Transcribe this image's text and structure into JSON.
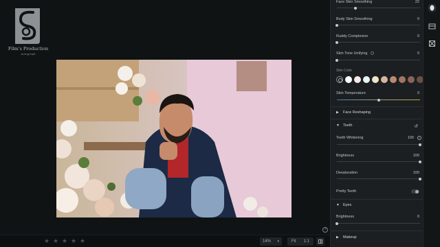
{
  "logo": {
    "title": "Film's Production",
    "subtitle": "Autograph"
  },
  "panel": {
    "rows_top": [
      {
        "label": "Face Skin Smoothing",
        "value": "22",
        "level": 0.22
      },
      {
        "label": "Body Skin Smoothing",
        "value": "0",
        "level": 0
      },
      {
        "label": "Ruddy Complexion",
        "value": "0",
        "level": 0
      },
      {
        "label": "Skin Tone Unifying",
        "value": "0",
        "level": 0
      }
    ],
    "skin_color_label": "Skin Color",
    "skin_colors": [
      "#ffffff",
      "#f6ebe6",
      "#e8f4f8",
      "#f2e4cc",
      "#d9b59e",
      "#b78b72",
      "#9f7564",
      "#8a6557",
      "#6d4e42"
    ],
    "skin_temperature": {
      "label": "Skin Temperature",
      "value": "0",
      "level": 0.5
    },
    "sections": {
      "face_reshaping": "Face Reshaping",
      "teeth": "Teeth",
      "eyes": "Eyes",
      "makeup": "Makeup"
    },
    "teeth_rows": [
      {
        "label": "Teeth Whitening",
        "value": "100",
        "level": 1
      },
      {
        "label": "Brightness",
        "value": "100",
        "level": 1
      },
      {
        "label": "Desaturation",
        "value": "100",
        "level": 1
      }
    ],
    "pretty_teeth": {
      "label": "Pretty Teeth",
      "on": false
    },
    "eyes_rows": [
      {
        "label": "Brightness",
        "value": "0",
        "level": 0
      }
    ]
  },
  "bottom": {
    "stars": [
      "★",
      "★",
      "★",
      "★",
      "★"
    ],
    "zoom": "14%",
    "fit_label": "Fit",
    "one_to_one": "1:1"
  },
  "rail": {
    "icons": [
      "face-icon",
      "panel-icon",
      "crop-icon"
    ]
  },
  "colors": {
    "background": "#101314",
    "panel": "#1b1f21",
    "accent": "#c3a33d"
  }
}
